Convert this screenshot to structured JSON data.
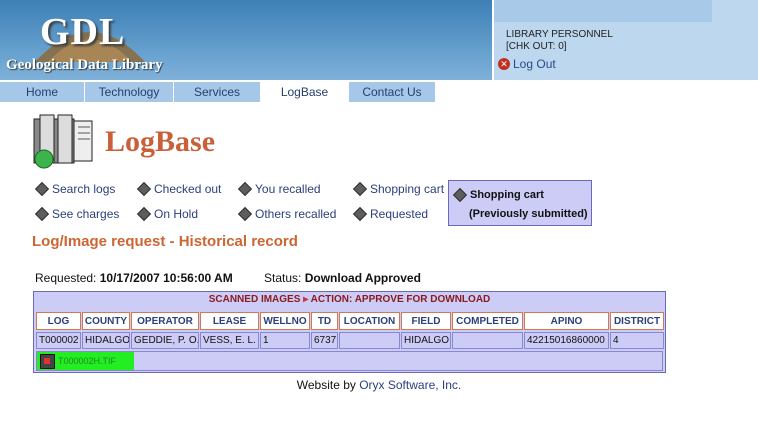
{
  "header": {
    "logo_main": "GDL",
    "logo_sub": "Geological Data Library",
    "user_name": "LIBRARY PERSONNEL",
    "chk_out": "[CHK OUT: 0]",
    "logout_label": "Log Out"
  },
  "nav": {
    "tabs": [
      {
        "label": "Home"
      },
      {
        "label": "Technology"
      },
      {
        "label": "Services"
      },
      {
        "label": "LogBase",
        "active": true
      },
      {
        "label": "Contact Us"
      }
    ]
  },
  "page": {
    "title": "LogBase",
    "heading": "Log/Image request - Historical record",
    "requested_label": "Requested:",
    "requested_value": "10/17/2007 10:56:00 AM",
    "status_label": "Status:",
    "status_value": "Download Approved"
  },
  "links": {
    "search_logs": "Search logs",
    "checked_out": "Checked out",
    "you_recalled": "You recalled",
    "shopping_cart": "Shopping cart",
    "see_charges": "See charges",
    "on_hold": "On Hold",
    "others_recalled": "Others recalled",
    "requested": "Requested",
    "selected_line1": "Shopping cart",
    "selected_line2": "(Previously submitted)"
  },
  "table": {
    "banner_left": "SCANNED IMAGES",
    "banner_arrow": "▸",
    "banner_right": "ACTION: APPROVE FOR DOWNLOAD",
    "columns": [
      "LOG",
      "COUNTY",
      "OPERATOR",
      "LEASE",
      "WELLNO",
      "TD",
      "LOCATION",
      "FIELD",
      "COMPLETED",
      "APINO",
      "DISTRICT"
    ],
    "row": [
      "T000002",
      "HIDALGO",
      "GEDDIE, P. O.",
      "VESS, E. L.",
      "1",
      "6737",
      "",
      "HIDALGO",
      "",
      "42215016860000",
      "4"
    ],
    "file_label": "T000002H.TIF"
  },
  "footer": {
    "prefix": "Website by",
    "link": "Oryx Software, Inc."
  },
  "colors": {
    "header_blue": "#3d7fb5",
    "tab_blue": "#a6c8e8",
    "accent_orange": "#cc6633",
    "table_bg": "#ccccf7",
    "file_green": "#22ee22"
  }
}
